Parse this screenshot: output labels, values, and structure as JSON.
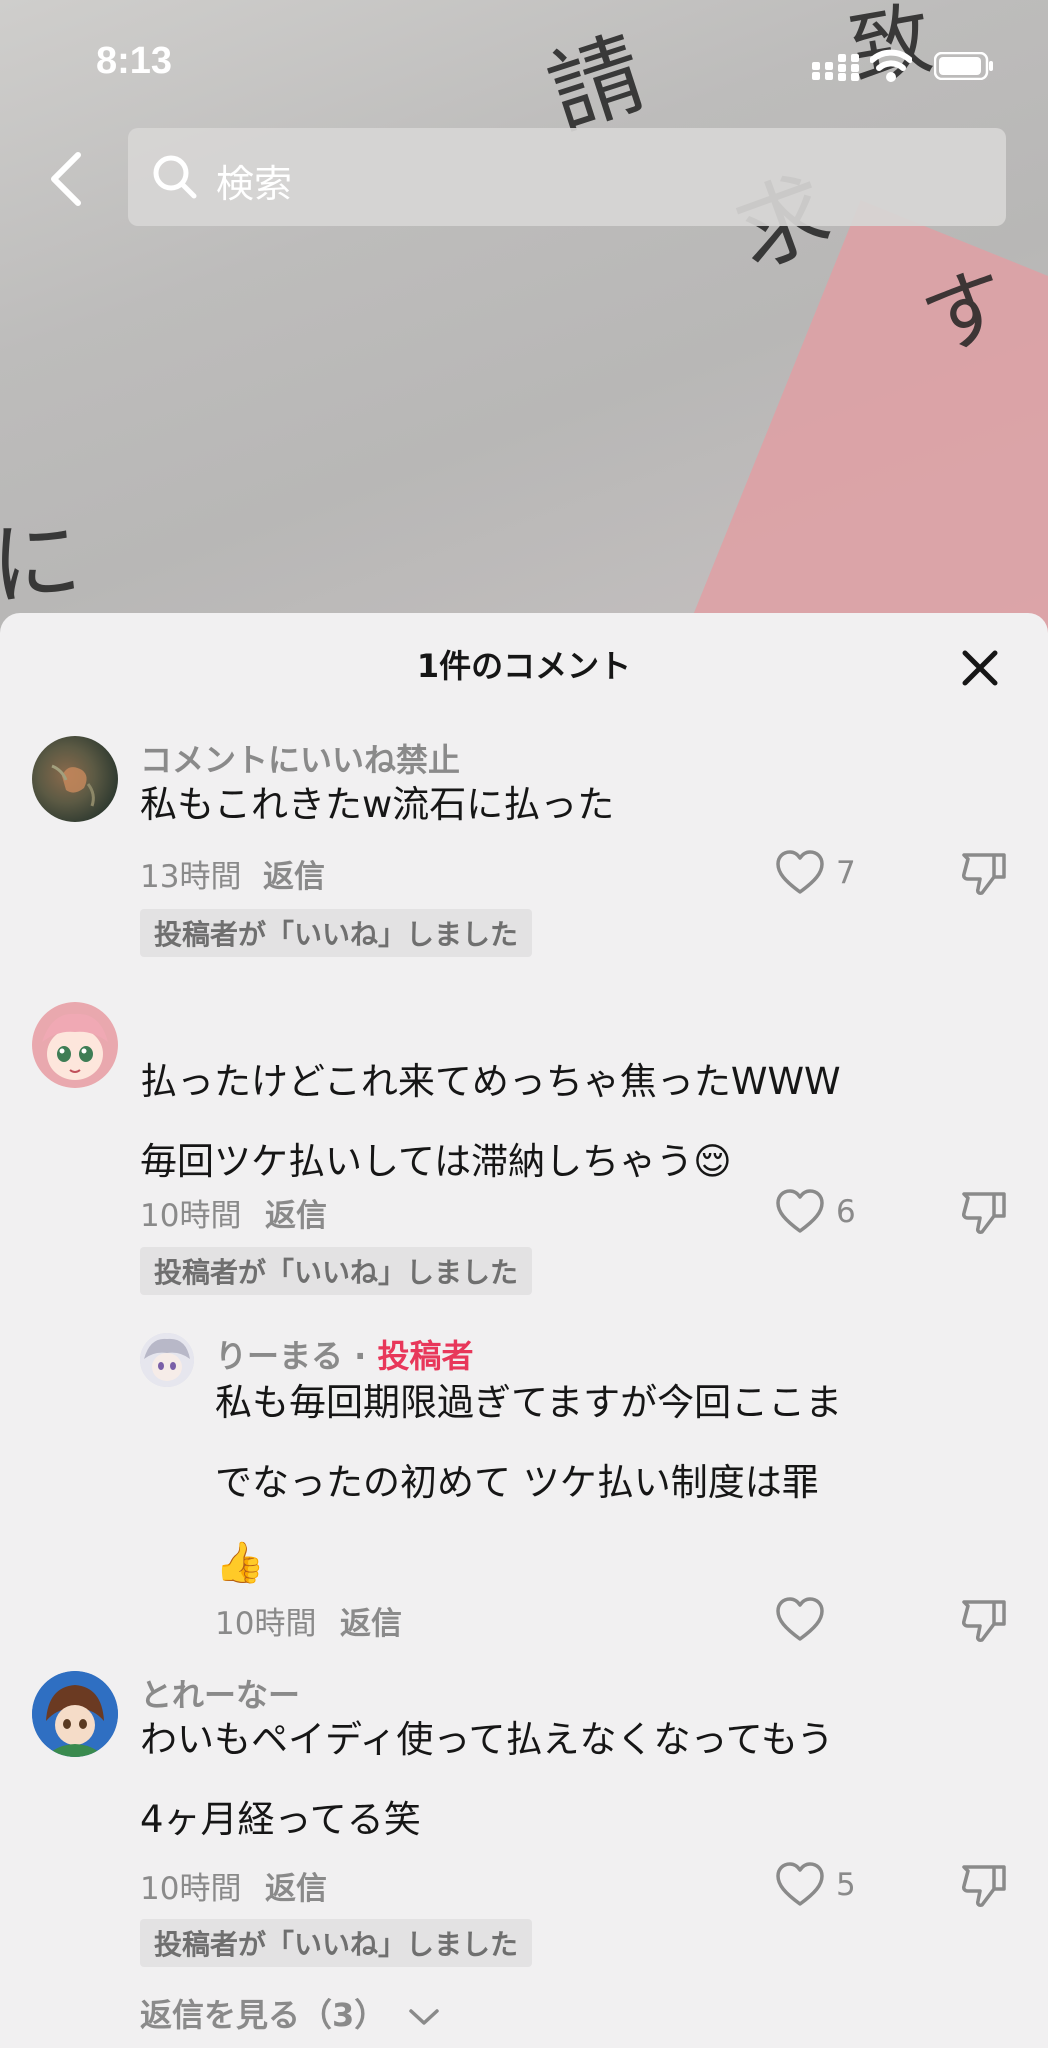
{
  "status_bar": {
    "time": "8:13"
  },
  "search": {
    "placeholder": "検索"
  },
  "background": {
    "glyphs": [
      "請",
      "致",
      "求",
      "す",
      "に"
    ]
  },
  "sheet": {
    "title": "1件のコメント"
  },
  "comments": [
    {
      "username": "コメントにいいね禁止",
      "text_lines": [
        "私もこれきたw流石に払った"
      ],
      "time": "13時間",
      "reply_label": "返信",
      "likes": "7",
      "badge": "投稿者が「いいね」しました"
    },
    {
      "username": "",
      "text_lines": [
        "払ったけどこれ来てめっちゃ焦ったWWW",
        "毎回ツケ払いしては滞納しちゃう😌"
      ],
      "time": "10時間",
      "reply_label": "返信",
      "likes": "6",
      "badge": "投稿者が「いいね」しました",
      "reply": {
        "username": "りーまる",
        "separator": " · ",
        "author_tag": "投稿者",
        "text_lines": [
          "私も毎回期限過ぎてますが今回ここま",
          "でなったの初めて ツケ払い制度は罪",
          "👍"
        ],
        "time": "10時間",
        "reply_label": "返信"
      }
    },
    {
      "username": "とれーなー",
      "text_lines": [
        "わいもペイディ使って払えなくなってもう",
        "4ヶ月経ってる笑"
      ],
      "time": "10時間",
      "reply_label": "返信",
      "likes": "5",
      "badge": "投稿者が「いいね」しました",
      "view_replies": "返信を見る（3）"
    }
  ],
  "colors": {
    "accent": "#e8375a",
    "text": "#161616",
    "muted": "#8a8a8a"
  }
}
